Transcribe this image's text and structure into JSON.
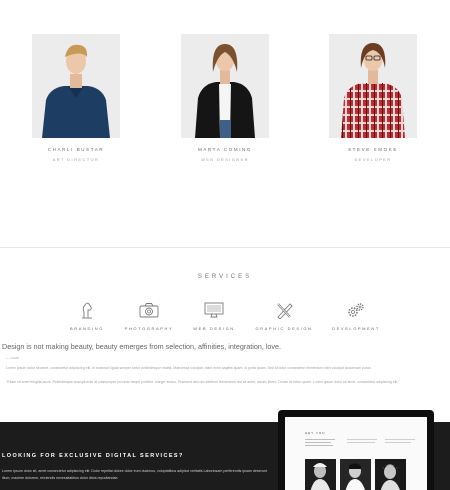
{
  "team": [
    {
      "name": "CHARLI BUSTAR",
      "role": "ART DIRECTOR",
      "photo": "person-photo-navy-sweater"
    },
    {
      "name": "MARTA COMING",
      "role": "WEB DESIGNER",
      "photo": "person-photo-black-jacket"
    },
    {
      "name": "STEVE SMOKE",
      "role": "DEVELOPER",
      "photo": "person-photo-plaid-shirt"
    }
  ],
  "services": {
    "title": "SERVICES",
    "items": [
      {
        "label": "BRANDING",
        "icon": "horse-head-icon"
      },
      {
        "label": "PHOTOGRAPHY",
        "icon": "camera-icon"
      },
      {
        "label": "WEB DESIGN",
        "icon": "monitor-icon"
      },
      {
        "label": "GRAPHIC DESIGN",
        "icon": "pencil-ruler-icon"
      },
      {
        "label": "DEVELOPMENT",
        "icon": "gears-icon"
      }
    ]
  },
  "about": {
    "tagline": "Design is not making beauty, beauty emerges from selection, affinities, integration, love.",
    "label": "— Louis",
    "paragraph1": "Lorem ipsum dolor sit amet, consectetur adipiscing elit. In euismod ligula semper tortor pellentesque mattis. Maecenas volutpat, diam enim sagittis quam, id porta quam. Sed id dolor consectetur fermentum nibh volutpat accumsan purus.",
    "paragraph2": "\"Etiam sit amet fringilla lacus. Pellentesque suscipit ante at ullamcorper pulvinar neque porttitor. Integer lectus. Praesent sed nisi eleifend fermentum nisl sit amet, iaculis libero. Donec et tortor quam. Lorem ipsum dolor sit amet, consectetur adipiscing elit.\""
  },
  "cta": {
    "title": "LOOKING FOR EXCLUSIVE DIGITAL SERVICES?",
    "text": "Lorem ipsum dolor sit, amet consectetur adipisicing elit. Dolor repellat dolore dolor eum ducimus, voluptatibus adipisci veritatis Laboriosam perferendis ipsam deserunt illum, maxime dolorem, reiciendis necessitatibus dolor dicta repudiandae."
  },
  "laptop": {
    "screen_title": "HEY YOU"
  },
  "colors": {
    "background": "#ffffff",
    "dark_band": "#1c1c1c",
    "text_muted": "#a3a3a3",
    "icon_stroke": "#7a7a7a"
  }
}
